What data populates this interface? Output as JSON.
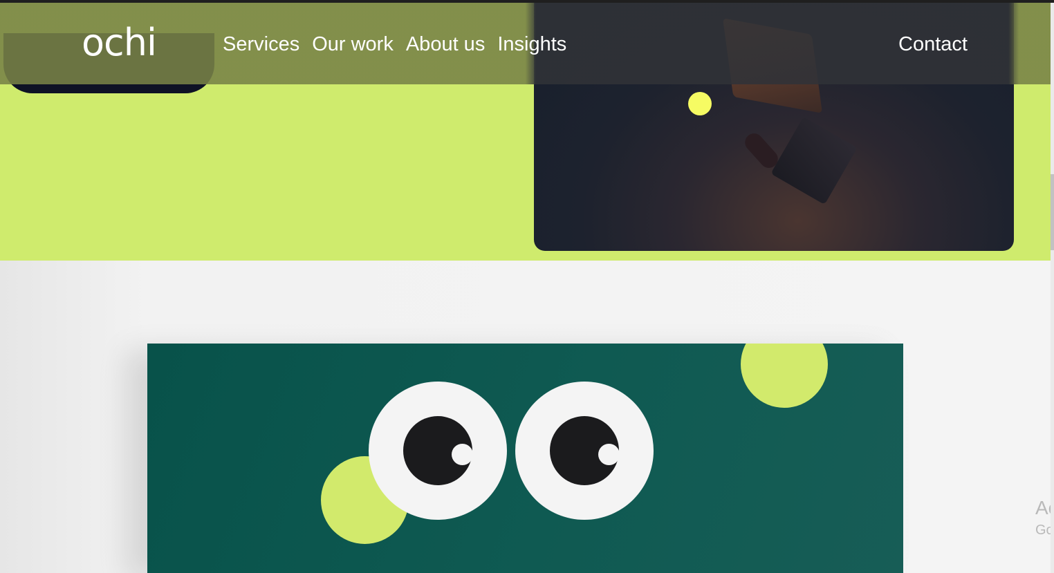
{
  "brand": {
    "logo_text": "ochi"
  },
  "nav": {
    "items": [
      {
        "label": "Services"
      },
      {
        "label": "Our work"
      },
      {
        "label": "About us"
      },
      {
        "label": "Insights"
      }
    ],
    "contact_label": "Contact"
  },
  "watermark": {
    "line1": "Ac",
    "line2": "Go"
  },
  "colors": {
    "hero_bg": "#cfeb6d",
    "panel_green": "#0f5a52",
    "eye_white": "#f4f4f4",
    "pupil": "#1b1b1d",
    "accent_dot": "#f6fb63"
  }
}
